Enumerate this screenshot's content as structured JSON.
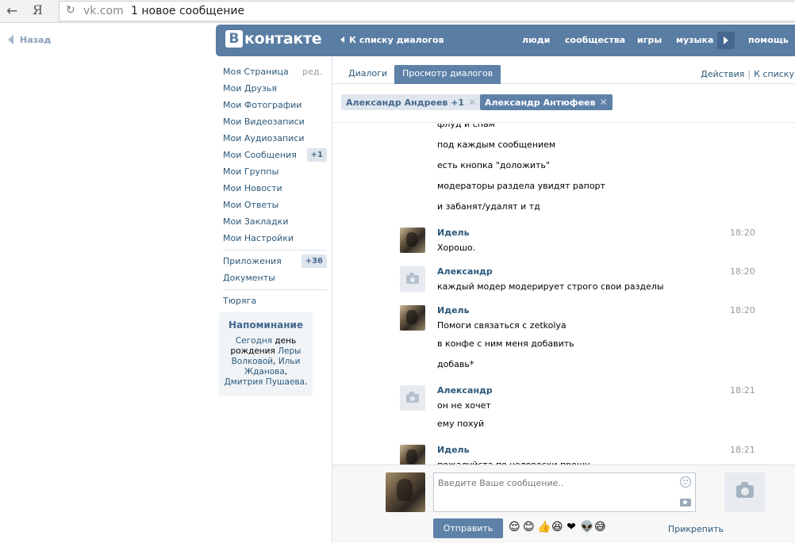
{
  "browser": {
    "ya": "Я",
    "domain": "vk.com",
    "tab_title": "1 новое сообщение"
  },
  "back_label": "Назад",
  "header": {
    "logo_letter": "В",
    "logo_word": "контакте",
    "back_to_list": "К списку диалогов",
    "nav": [
      "люди",
      "сообщества",
      "игры",
      "музыка",
      "помощь"
    ]
  },
  "menu": {
    "items": [
      {
        "label": "Моя Страница",
        "aux": "ред."
      },
      {
        "label": "Мои Друзья"
      },
      {
        "label": "Мои Фотографии"
      },
      {
        "label": "Мои Видеозаписи"
      },
      {
        "label": "Мои Аудиозаписи"
      },
      {
        "label": "Мои Сообщения",
        "count": "+1"
      },
      {
        "label": "Мои Группы"
      },
      {
        "label": "Мои Новости"
      },
      {
        "label": "Мои Ответы"
      },
      {
        "label": "Мои Закладки"
      },
      {
        "label": "Мои Настройки"
      }
    ],
    "apps": {
      "label": "Приложения",
      "count": "+36"
    },
    "docs": "Документы",
    "extra": "Тюряга"
  },
  "reminder": {
    "title": "Напоминание",
    "today": "Сегодня",
    "birthday_text": "день рождения",
    "names": [
      "Леры Волковой",
      "Ильи Жданова",
      "Дмитрия Пушаева"
    ],
    "sep1": ", ",
    "sep2": ", ",
    "end": "."
  },
  "tabs": {
    "dialogs": "Диалоги",
    "view": "Просмотр диалогов",
    "actions": "Действия",
    "to_list": "К списку"
  },
  "participants": [
    {
      "name": "Александр Андреев +1"
    },
    {
      "name": "Александр Антюфеев"
    }
  ],
  "history": {
    "lines": [
      {
        "type": "text",
        "text": "флуд и спам"
      },
      {
        "type": "text",
        "text": "под каждым сообщением"
      },
      {
        "type": "text",
        "text": "есть кнопка \"доложить\""
      },
      {
        "type": "text",
        "text": "модераторы раздела увидят рапорт"
      },
      {
        "type": "text",
        "text": "и забанят/удалят и тд"
      },
      {
        "type": "head",
        "author": "Идель",
        "time": "18:20",
        "avatar": "photo",
        "text": "Хорошо."
      },
      {
        "type": "head",
        "author": "Александр",
        "time": "18:20",
        "avatar": "camera",
        "text": "каждый модер модерирует строго свои разделы"
      },
      {
        "type": "head",
        "author": "Идель",
        "time": "18:20",
        "avatar": "photo",
        "text": "Помоги связаться с zetkolya"
      },
      {
        "type": "text",
        "text": "в конфе с ним меня добавить"
      },
      {
        "type": "text",
        "text": "добавь*"
      },
      {
        "type": "head",
        "author": "Александр",
        "time": "18:21",
        "avatar": "camera",
        "text": "он не хочет"
      },
      {
        "type": "text",
        "text": "ему похуй"
      },
      {
        "type": "head",
        "author": "Идель",
        "time": "18:21",
        "avatar": "photo",
        "text": "пожалуйста по человески прошу"
      }
    ]
  },
  "compose": {
    "placeholder": "Введите Ваше сообщение..",
    "send": "Отправить",
    "attach": "Прикрепить",
    "emojis": [
      "😌",
      "😊",
      "👍",
      "😆",
      "❤",
      "👽",
      "😅"
    ]
  },
  "colors": {
    "header_bg": "#597da3",
    "link": "#2b587a",
    "button": "#5e81a8"
  }
}
